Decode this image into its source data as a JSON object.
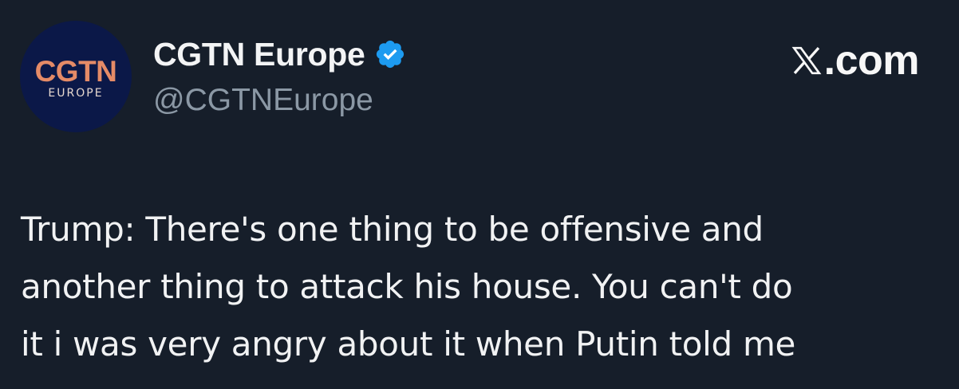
{
  "account": {
    "avatar_main": "CGTN",
    "avatar_sub": "EUROPE",
    "display_name": "CGTN Europe",
    "handle": "@CGTNEurope",
    "verified_icon": "verified-badge-icon"
  },
  "branding": {
    "site": ".com",
    "logo_icon": "x-logo-icon"
  },
  "tweet": {
    "text": "Trump: There's one thing to be offensive and\nanother thing to attack his house. You can't do\nit i was very angry about it when Putin told me"
  },
  "colors": {
    "background": "#161e2a",
    "avatar_bg": "#0b1848",
    "avatar_accent": "#e58b67",
    "verified_blue": "#1d9bf0",
    "handle_gray": "#8b98a5"
  }
}
